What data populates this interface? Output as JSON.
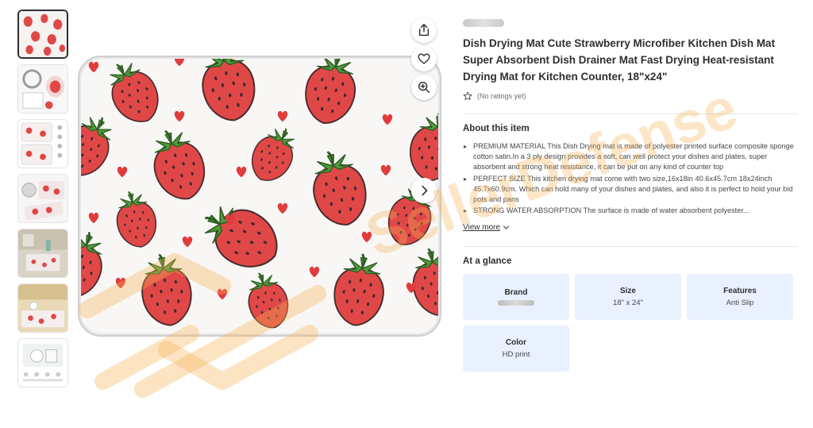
{
  "product": {
    "title": "Dish Drying Mat Cute Strawberry Microfiber Kitchen Dish Mat Super Absorbent Dish Drainer Mat Fast Drying Heat-resistant Drying Mat for Kitchen Counter, 18\"x24\"",
    "ratings_text": "(No ratings yet)"
  },
  "about": {
    "heading": "About this item",
    "bullets": [
      "PREMIUM MATERIAL This Dish Drying mat is made of polyester printed surface composite sponge cotton satin.In a 3 ply design provides a soft, can well protect your dishes and plates, super absorbent and strong heat resistance, it can be put on any kind of counter top",
      "PERFECT SIZE This kitchen drying mat come with two size,16x18in 40.6x45.7cm 18x24inch 45.7x60.9cm. Which can hold many of your dishes and plates, and also it is perfect to hold your bid pots and pans",
      "STRONG WATER ABSORPTION The surface is made of water absorbent polyester..."
    ],
    "view_more": "View more"
  },
  "glance": {
    "heading": "At a glance",
    "cards": [
      {
        "label": "Brand",
        "value": ""
      },
      {
        "label": "Size",
        "value": "18\" x 24\""
      },
      {
        "label": "Features",
        "value": "Anti Slip"
      },
      {
        "label": "Color",
        "value": "HD print"
      }
    ]
  },
  "watermark": {
    "text": "SellerDefense"
  },
  "icons": {
    "share": "share-icon",
    "heart": "heart-icon",
    "zoom": "zoom-in-icon",
    "next": "chevron-right-icon",
    "star": "star-outline-icon",
    "view_more_chevron": "chevron-down-icon"
  },
  "colors": {
    "glance_card_bg": "#e8f1fd",
    "strawberry_red": "#e04848",
    "watermark": "#f6b252",
    "text": "#2e2f32"
  },
  "thumbnails_count": 7,
  "active_thumbnail_index": 0
}
